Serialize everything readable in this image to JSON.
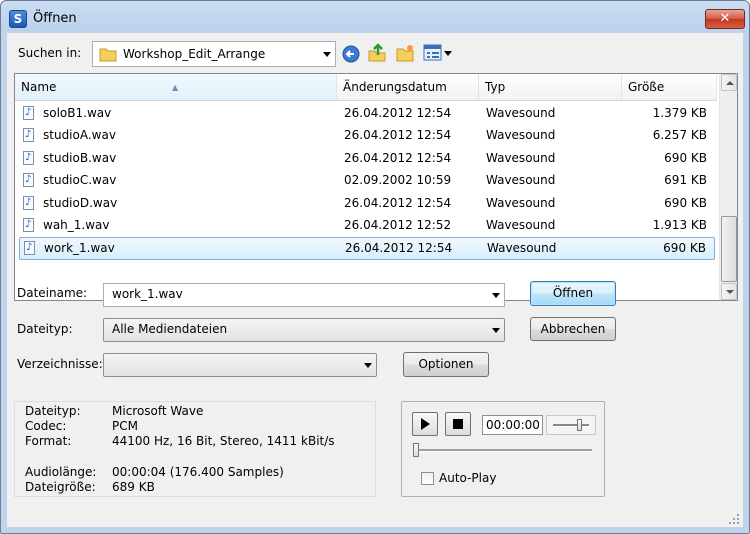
{
  "window": {
    "title": "Öffnen",
    "close_symbol": "✕"
  },
  "lookin": {
    "label": "Suchen in:",
    "value": "Workshop_Edit_Arrange"
  },
  "toolbar": {
    "icons": [
      "back-icon",
      "up-folder-icon",
      "new-folder-icon",
      "view-menu-icon"
    ]
  },
  "list": {
    "columns": [
      "Name",
      "Änderungsdatum",
      "Typ",
      "Größe"
    ],
    "rows": [
      {
        "name": "soloB1.wav",
        "date": "26.04.2012 12:54",
        "type": "Wavesound",
        "size": "1.379 KB"
      },
      {
        "name": "studioA.wav",
        "date": "26.04.2012 12:54",
        "type": "Wavesound",
        "size": "6.257 KB"
      },
      {
        "name": "studioB.wav",
        "date": "26.04.2012 12:54",
        "type": "Wavesound",
        "size": "690 KB"
      },
      {
        "name": "studioC.wav",
        "date": "02.09.2002 10:59",
        "type": "Wavesound",
        "size": "691 KB"
      },
      {
        "name": "studioD.wav",
        "date": "26.04.2012 12:54",
        "type": "Wavesound",
        "size": "690 KB"
      },
      {
        "name": "wah_1.wav",
        "date": "26.04.2012 12:52",
        "type": "Wavesound",
        "size": "1.913 KB"
      },
      {
        "name": "work_1.wav",
        "date": "26.04.2012 12:54",
        "type": "Wavesound",
        "size": "690 KB"
      }
    ],
    "selected_row": "work_1.wav"
  },
  "form": {
    "filename_label": "Dateiname:",
    "filename_value": "work_1.wav",
    "filetype_label": "Dateityp:",
    "filetype_value": "Alle Mediendateien",
    "dirs_label": "Verzeichnisse:",
    "dirs_value": ""
  },
  "buttons": {
    "open": "Öffnen",
    "cancel": "Abbrechen",
    "options": "Optionen"
  },
  "info": {
    "filetype_key": "Dateityp:",
    "filetype_val": "Microsoft Wave",
    "codec_key": "Codec:",
    "codec_val": "PCM",
    "format_key": "Format:",
    "format_val": "44100 Hz, 16 Bit, Stereo, 1411 kBit/s",
    "length_key": "Audiolänge:",
    "length_val": "00:00:04  (176.400 Samples)",
    "size_key": "Dateigröße:",
    "size_val": "689 KB"
  },
  "player": {
    "time": "00:00:00",
    "autoplay_label": "Auto-Play",
    "autoplay_checked": false,
    "position": 0
  },
  "colors": {
    "titlebar": "#bfd3ea",
    "selection": "#d5effc",
    "close": "#c0381f"
  }
}
